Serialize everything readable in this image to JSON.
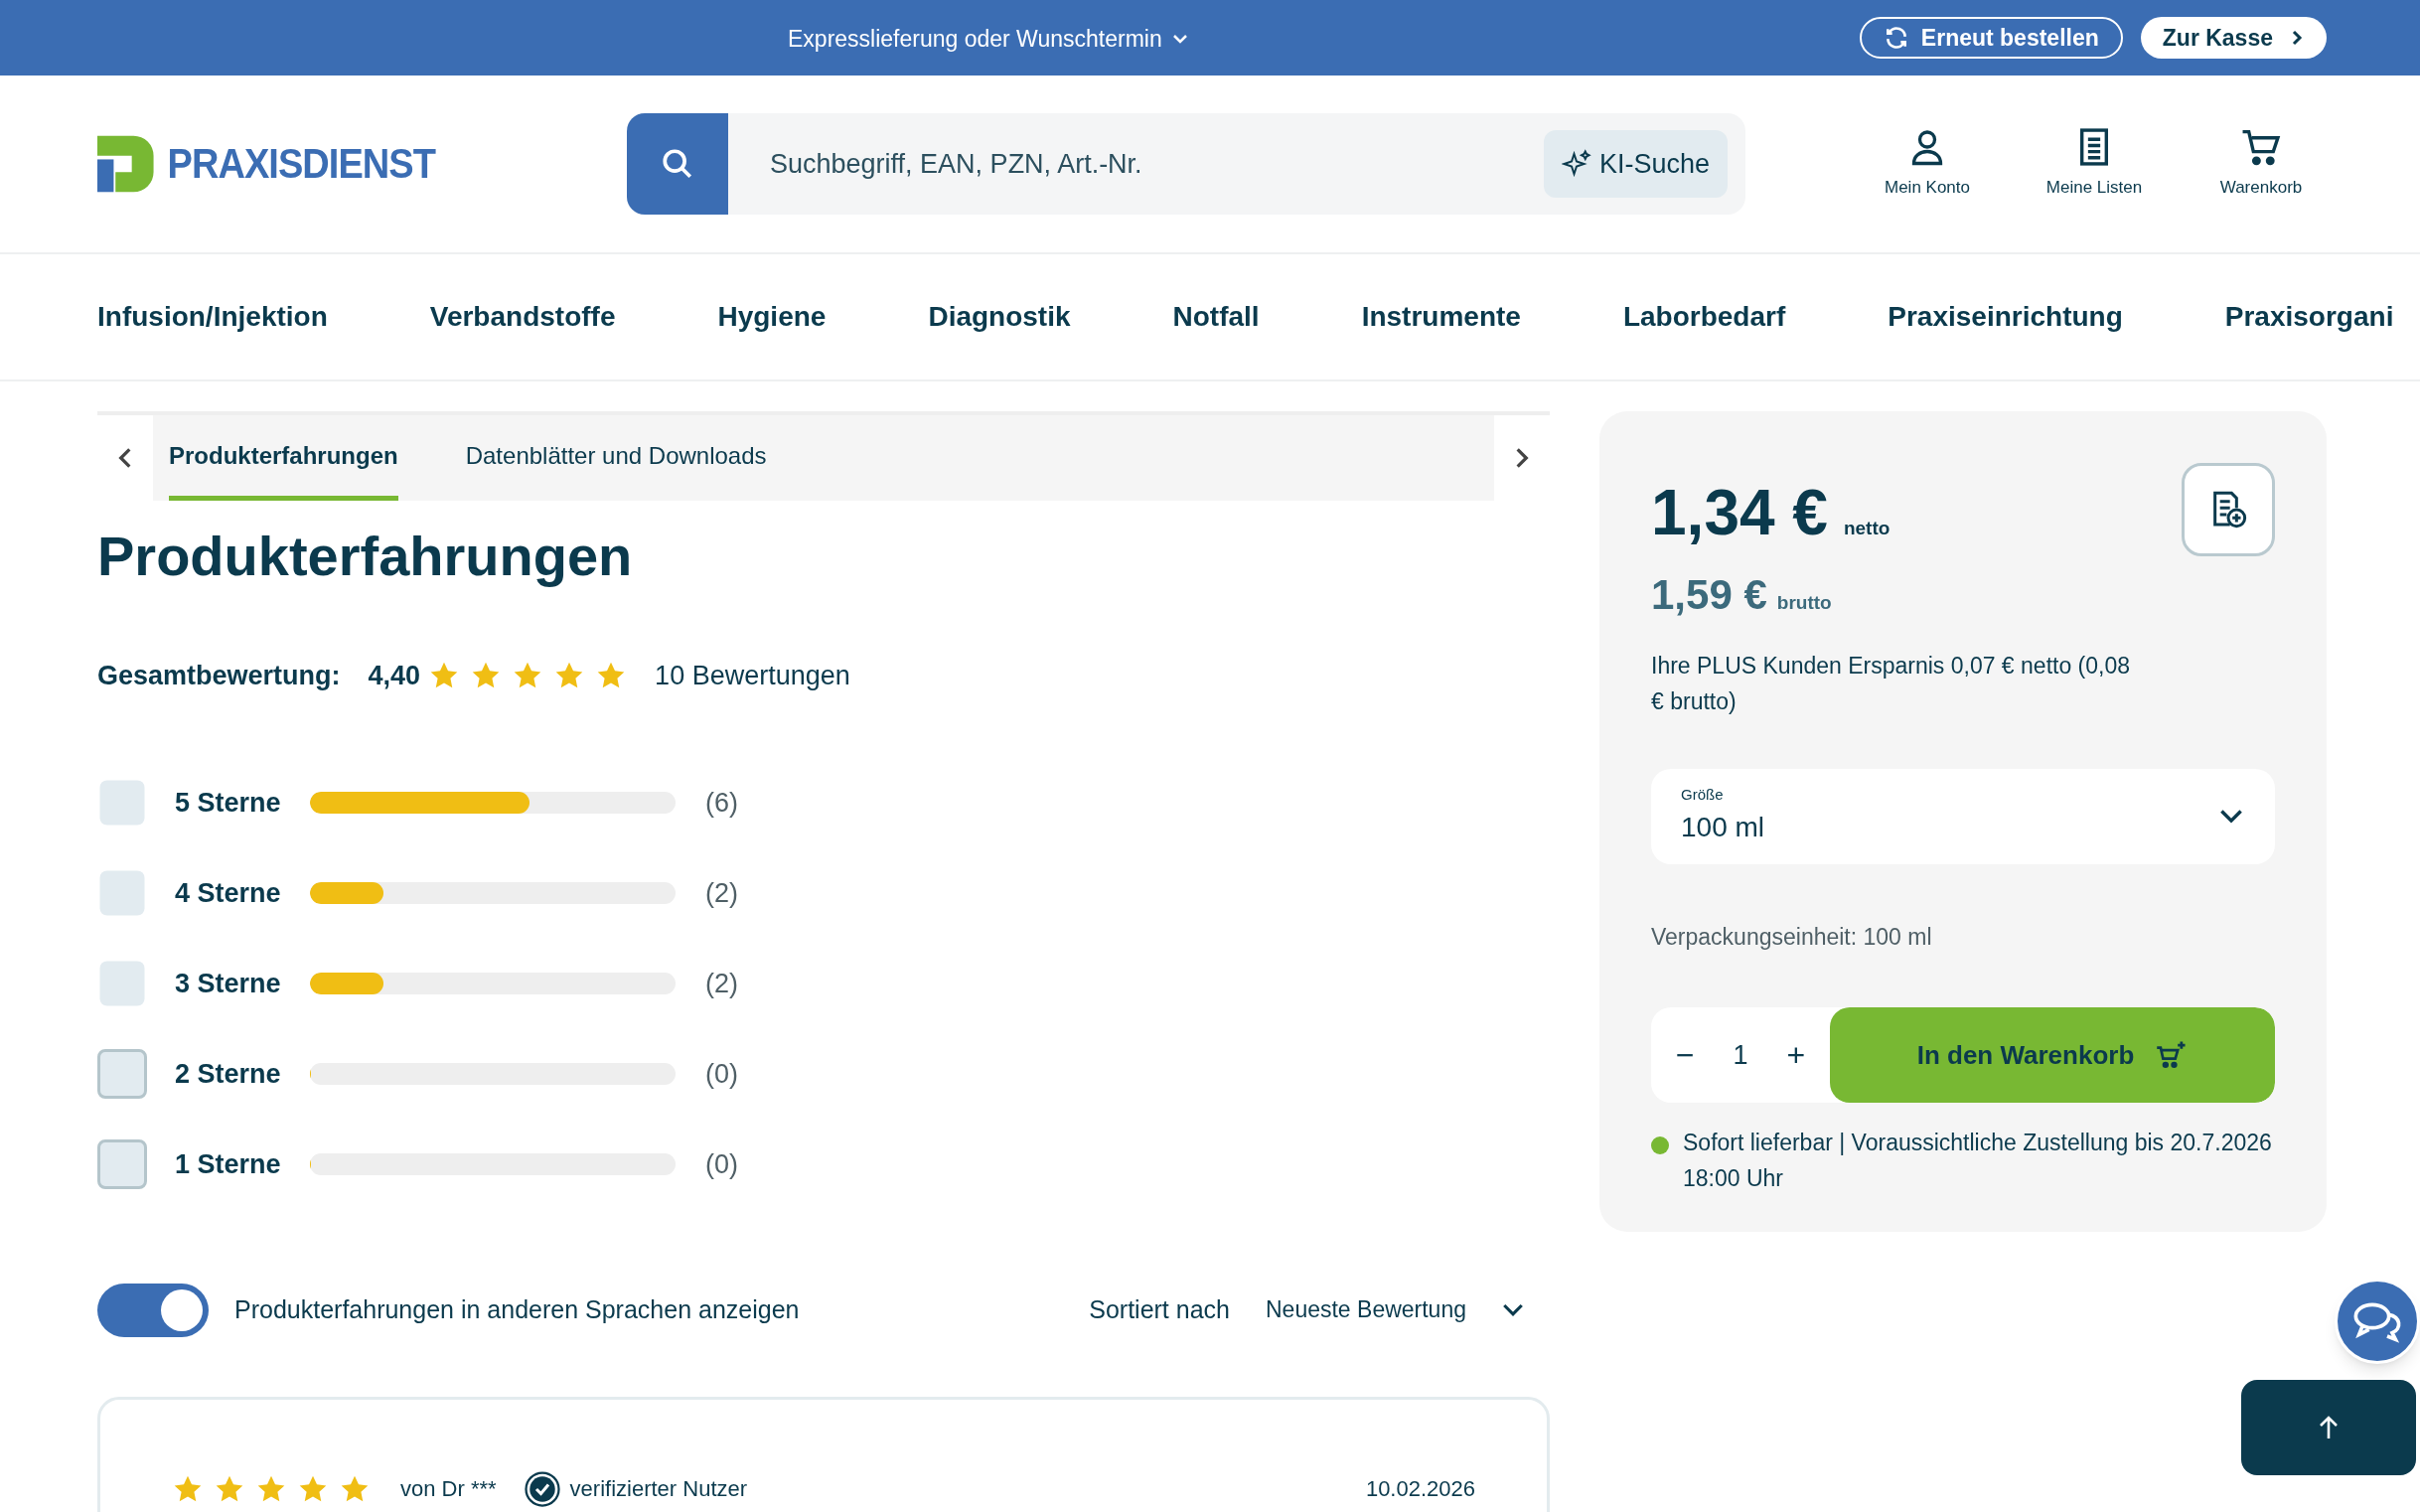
{
  "top_bar": {
    "delivery": "Expresslieferung oder Wunschtermin",
    "reorder_button": "Erneut bestellen",
    "checkout_button": "Zur Kasse"
  },
  "header": {
    "logo": "PRAXISDIENST",
    "search": {
      "placeholder": "Suchbegriff, EAN, PZN, Art.-Nr.",
      "ai_button": "KI-Suche"
    },
    "actions": [
      {
        "kind": "account",
        "label": "Mein Konto"
      },
      {
        "kind": "lists",
        "label": "Meine Listen"
      },
      {
        "kind": "cart",
        "label": "Warenkorb"
      }
    ]
  },
  "nav": [
    "Infusion/Injektion",
    "Verbandstoffe",
    "Hygiene",
    "Diagnostik",
    "Notfall",
    "Instrumente",
    "Laborbedarf",
    "Praxiseinrichtung",
    "Praxisorgani"
  ],
  "tabs": [
    {
      "label": "Produkterfahrungen",
      "selected": true
    },
    {
      "label": "Datenblätter und Downloads",
      "selected": false
    }
  ],
  "reviews": {
    "heading": "Produkterfahrungen",
    "overall_label": "Gesamtbewertung:",
    "overall_value": "4,40",
    "stars": 5,
    "count": "10 Bewertungen",
    "filters": [
      {
        "label": "5 Sterne",
        "level": 0.6,
        "count": "(6)",
        "outlined": false
      },
      {
        "label": "4 Sterne",
        "level": 0.2,
        "count": "(2)",
        "outlined": false
      },
      {
        "label": "3 Sterne",
        "level": 0.2,
        "count": "(2)",
        "outlined": false
      },
      {
        "label": "2 Sterne",
        "level": 0,
        "count": "(0)",
        "outlined": true
      },
      {
        "label": "1 Sterne",
        "level": 0,
        "count": "(0)",
        "outlined": true
      }
    ],
    "language_toggle": {
      "label": "Produkterfahrungen in anderen Sprachen anzeigen",
      "on": true
    },
    "sort": {
      "label": "Sortiert nach",
      "value": "Neueste Bewertung"
    },
    "items": [
      {
        "stars": 5,
        "author": "von Dr ***",
        "badge": "verifizierter Nutzer",
        "date": "10.02.2026"
      }
    ]
  },
  "buy_box": {
    "net_price": "1,34 €",
    "net_label": "netto",
    "gross_price": "1,59 €",
    "gross_label": "brutto",
    "savings": "Ihre PLUS Kunden Ersparnis 0,07 € netto (0,08 € brutto)",
    "size": {
      "label": "Größe",
      "value": "100 ml"
    },
    "packaging": "Verpackungseinheit: 100 ml",
    "quantity": {
      "minus": "−",
      "value": "1",
      "plus": "+"
    },
    "add_button": "In den Warenkorb",
    "availability": {
      "color": "#78b833",
      "text": "Sofort lieferbar | Voraussichtliche Zustellung bis 20.7.2026 18:00 Uhr"
    }
  }
}
